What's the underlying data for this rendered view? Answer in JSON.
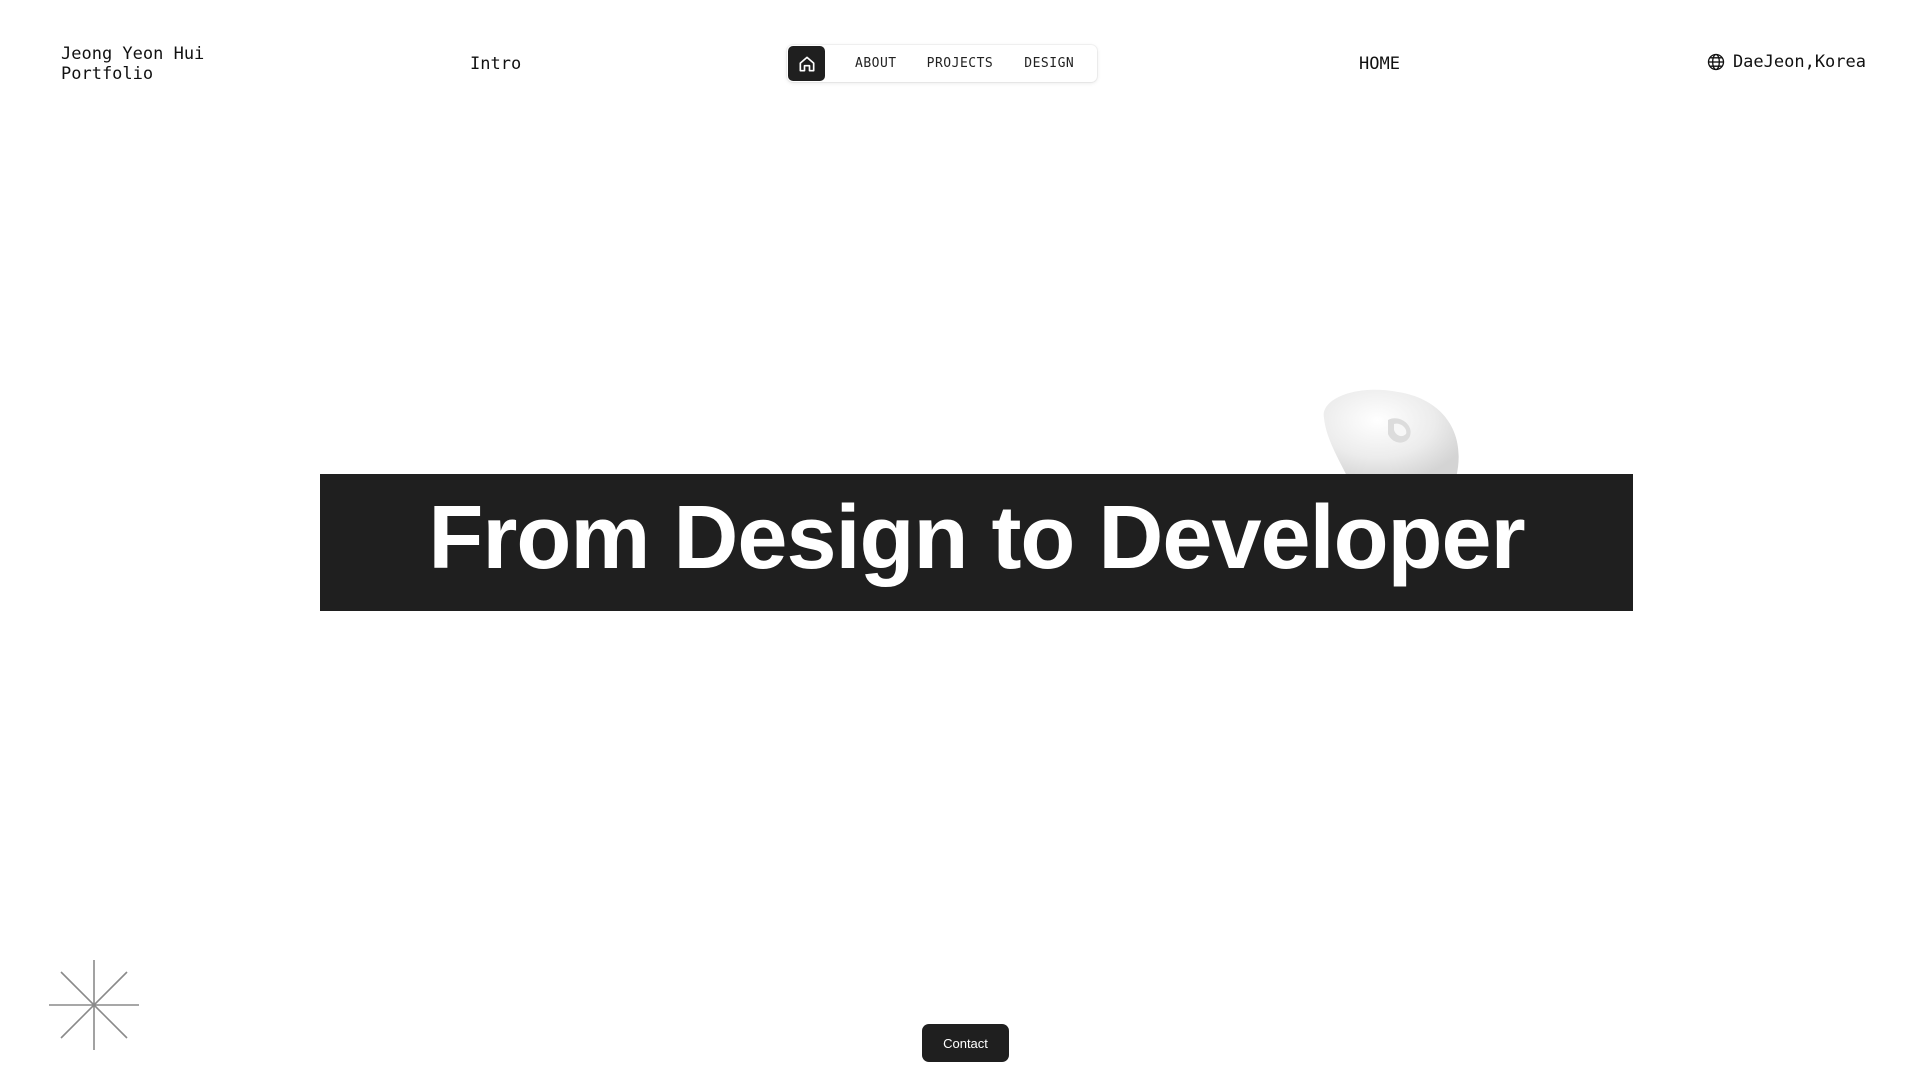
{
  "header": {
    "brand_line1": "Jeong Yeon Hui",
    "brand_line2": "Portfolio",
    "section_label": "Intro",
    "page_name": "HOME",
    "location": "DaeJeon,Korea",
    "location_icon": "globe-icon"
  },
  "nav": {
    "home_icon": "home-icon",
    "items": [
      {
        "label": "ABOUT"
      },
      {
        "label": "PROJECTS"
      },
      {
        "label": "DESIGN"
      }
    ]
  },
  "hero": {
    "title": "From Design to Developer"
  },
  "footer": {
    "contact_label": "Contact",
    "decor_icon": "asterisk-icon"
  },
  "colors": {
    "background": "#ffffff",
    "dark": "#1f1f1f",
    "text_light": "#ffffff"
  }
}
